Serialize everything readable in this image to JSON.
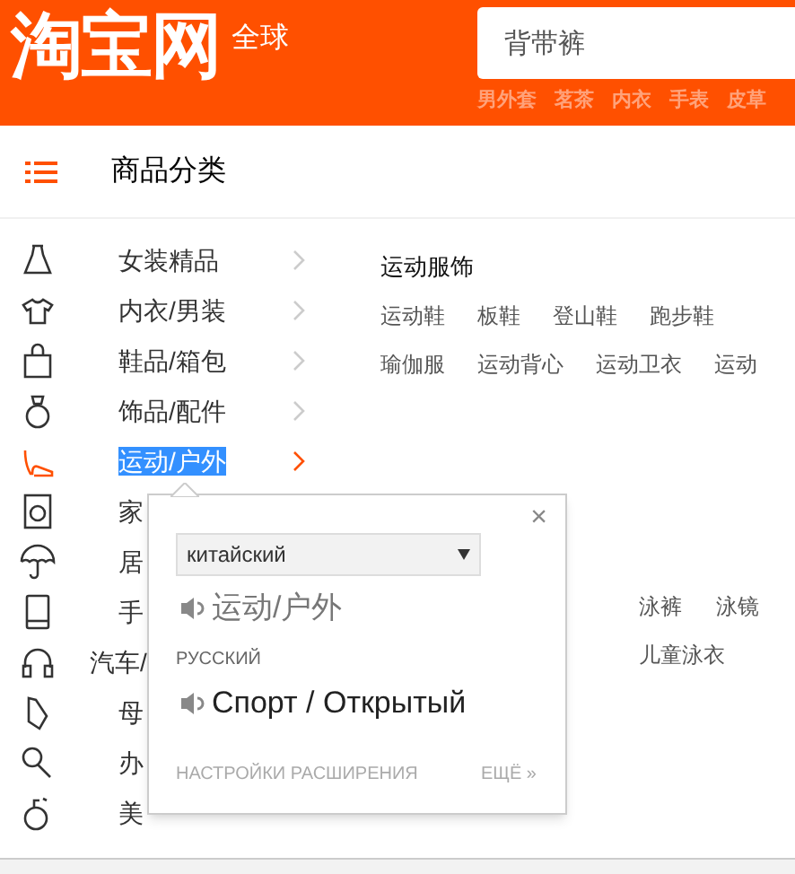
{
  "header": {
    "logo": "淘宝网",
    "region": "全球",
    "search": {
      "value": "背带裤"
    },
    "hot_words": [
      "男外套",
      "茗茶",
      "内衣",
      "手表",
      "皮草"
    ]
  },
  "category_title": "商品分类",
  "categories": [
    {
      "label": "女装精品",
      "selected": false
    },
    {
      "label": "内衣/男装",
      "selected": false
    },
    {
      "label": "鞋品/箱包",
      "selected": false
    },
    {
      "label": "饰品/配件",
      "selected": false
    },
    {
      "label": "运动/户外",
      "selected": true
    },
    {
      "label": "家",
      "selected": false
    },
    {
      "label": "居",
      "selected": false
    },
    {
      "label": "手",
      "selected": false
    },
    {
      "label": "汽车/",
      "selected": false
    },
    {
      "label": "母",
      "selected": false
    },
    {
      "label": "办",
      "selected": false
    },
    {
      "label": "美",
      "selected": false
    }
  ],
  "panel": {
    "heading": "运动服饰",
    "rows": [
      [
        "运动鞋",
        "板鞋",
        "登山鞋",
        "跑步鞋"
      ],
      [
        "瑜伽服",
        "运动背心",
        "运动卫衣",
        "运动"
      ]
    ]
  },
  "swim_panel": {
    "rows": [
      [
        "泳裤",
        "泳镜"
      ],
      [
        "儿童泳衣"
      ]
    ]
  },
  "translator": {
    "close": "×",
    "source_language": "китайский",
    "source_text": "运动/户外",
    "target_language": "РУССКИЙ",
    "translation": "Спорт / Открытый",
    "settings_link": "НАСТРОЙКИ РАСШИРЕНИЯ",
    "more_link": "ЕЩЁ »"
  }
}
